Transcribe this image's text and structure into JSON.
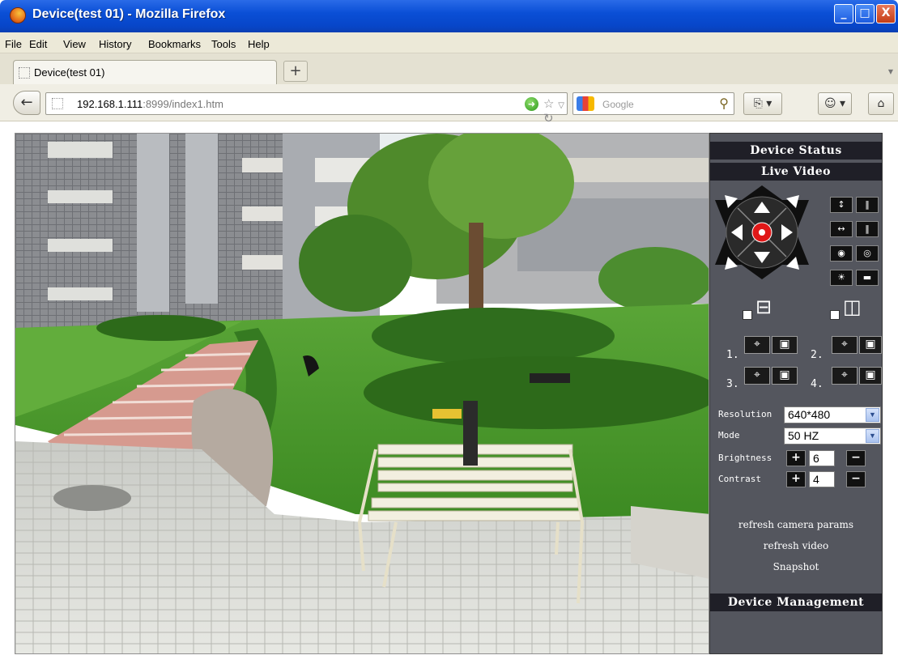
{
  "window": {
    "title": "Device(test 01) - Mozilla Firefox",
    "min": "_",
    "max": "□",
    "close": "X"
  },
  "menu": [
    "File",
    "Edit",
    "View",
    "History",
    "Bookmarks",
    "Tools",
    "Help"
  ],
  "tab": {
    "title": "Device(test 01)",
    "new_tab": "+"
  },
  "nav": {
    "url_host": "192.168.1.111",
    "url_rest": ":8999/index1.htm",
    "search_placeholder": "Google"
  },
  "panel": {
    "device_status": "Device Status",
    "live_video": "Live Video",
    "presets": [
      "1.",
      "2.",
      "3.",
      "4."
    ],
    "resolution_label": "Resolution",
    "resolution_value": "640*480",
    "mode_label": "Mode",
    "mode_value": "50 HZ",
    "brightness_label": "Brightness",
    "brightness_value": "6",
    "contrast_label": "Contrast",
    "contrast_value": "4",
    "refresh_params": "refresh camera params",
    "refresh_video": "refresh video",
    "snapshot": "Snapshot",
    "device_management": "Device Management"
  }
}
